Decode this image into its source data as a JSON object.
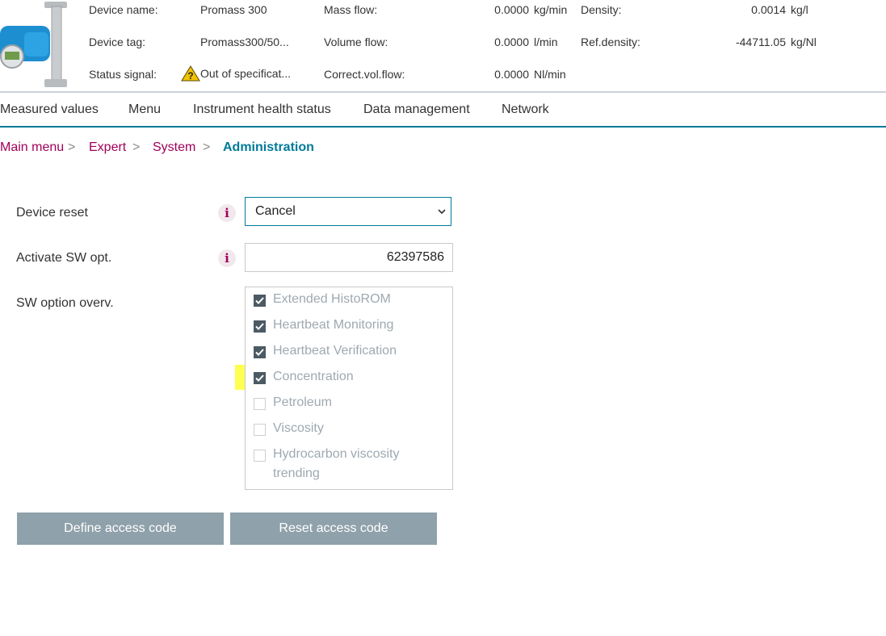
{
  "header": {
    "device_name_label": "Device name:",
    "device_name_value": "Promass 300",
    "device_tag_label": "Device tag:",
    "device_tag_value": "Promass300/50...",
    "status_signal_label": "Status signal:",
    "status_signal_value": "Out of specificat...",
    "mass_flow_label": "Mass flow:",
    "mass_flow_value": "0.0000",
    "mass_flow_unit": "kg/min",
    "volume_flow_label": "Volume flow:",
    "volume_flow_value": "0.0000",
    "volume_flow_unit": "l/min",
    "corr_vol_flow_label": "Correct.vol.flow:",
    "corr_vol_flow_value": "0.0000",
    "corr_vol_flow_unit": "Nl/min",
    "density_label": "Density:",
    "density_value": "0.0014",
    "density_unit": "kg/l",
    "ref_density_label": "Ref.density:",
    "ref_density_value": "-44711.05",
    "ref_density_unit": "kg/Nl"
  },
  "nav": {
    "items": [
      "Measured values",
      "Menu",
      "Instrument health status",
      "Data management",
      "Network"
    ]
  },
  "breadcrumb": {
    "items": [
      "Main menu",
      "Expert",
      "System"
    ],
    "separator": ">",
    "current": "Administration"
  },
  "form": {
    "device_reset_label": "Device reset",
    "device_reset_value": "Cancel",
    "activate_sw_label": "Activate SW opt.",
    "activate_sw_value": "62397586",
    "sw_overview_label": "SW option overv.",
    "options": [
      {
        "label": "Extended HistoROM",
        "checked": true
      },
      {
        "label": "Heartbeat Monitoring",
        "checked": true
      },
      {
        "label": "Heartbeat Verification",
        "checked": true
      },
      {
        "label": "Concentration",
        "checked": true
      },
      {
        "label": "Petroleum",
        "checked": false
      },
      {
        "label": "Viscosity",
        "checked": false
      },
      {
        "label": "Hydrocarbon viscosity trending",
        "checked": false
      }
    ]
  },
  "buttons": {
    "define_access": "Define access code",
    "reset_access": "Reset access code"
  },
  "colors": {
    "accent": "#007a99",
    "link": "#a0005a",
    "button": "#8fa1aa",
    "highlight": "#ffff33"
  }
}
